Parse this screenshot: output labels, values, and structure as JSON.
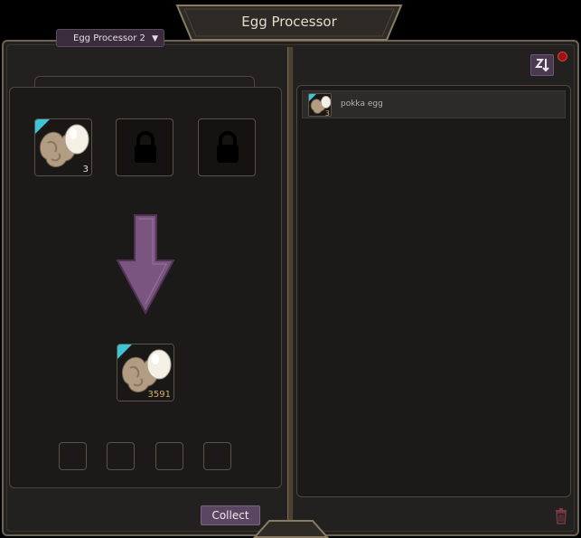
{
  "window": {
    "title": "Egg Processor"
  },
  "processor_select": {
    "value": "Egg Processor 2"
  },
  "input_slots": [
    {
      "state": "filled",
      "item": "egg-icon",
      "count": "3"
    },
    {
      "state": "locked",
      "icon": "lock-icon"
    },
    {
      "state": "locked",
      "icon": "lock-icon"
    }
  ],
  "output_slot": {
    "item": "egg-icon",
    "count": "3591"
  },
  "extra_slots": 4,
  "collect_button": {
    "label": "Collect"
  },
  "inventory": {
    "items": [
      {
        "name": "pokka egg",
        "count": "3",
        "icon": "egg-icon"
      }
    ]
  },
  "colors": {
    "accent_purple": "#7a5580",
    "rarity_cyan": "#3ec4d4",
    "gold_text": "#d4b06a"
  }
}
